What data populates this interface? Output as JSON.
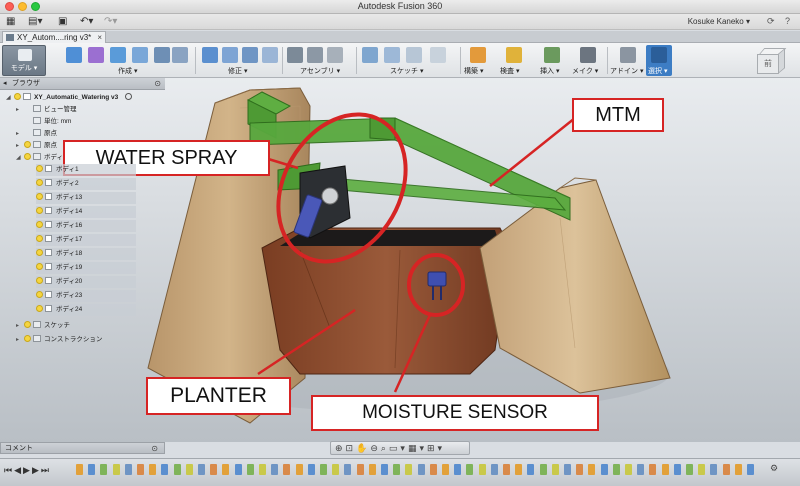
{
  "app": {
    "title": "Autodesk Fusion 360"
  },
  "user": {
    "name": "Kosuke Kaneko ▾"
  },
  "document_tab": {
    "label": "XY_Autom....ring v3*"
  },
  "workspace": {
    "label": "モデル ▾"
  },
  "toolbar": {
    "groups": [
      {
        "label": "作成 ▾"
      },
      {
        "label": "修正 ▾"
      },
      {
        "label": "アセンブリ ▾"
      },
      {
        "label": "スケッチ ▾"
      },
      {
        "label": "構築 ▾"
      },
      {
        "label": "検査 ▾"
      },
      {
        "label": "挿入 ▾"
      },
      {
        "label": "メイク ▾"
      },
      {
        "label": "アドイン ▾"
      },
      {
        "label": "選択 ▾"
      }
    ]
  },
  "viewcube": {
    "face": "前"
  },
  "browser": {
    "title": "ブラウザ",
    "root": "XY_Automatic_Watering v3",
    "items": [
      {
        "label": "ビュー管理"
      },
      {
        "label": "単位: mm"
      },
      {
        "label": "原点"
      },
      {
        "label": "原点"
      },
      {
        "label": "ボディ"
      }
    ],
    "bodies": [
      "ボディ1",
      "ボディ2",
      "ボディ13",
      "ボディ14",
      "ボディ16",
      "ボディ17",
      "ボディ18",
      "ボディ19",
      "ボディ20",
      "ボディ23",
      "ボディ24"
    ],
    "tail": [
      {
        "label": "スケッチ"
      },
      {
        "label": "コンストラクション"
      }
    ]
  },
  "comment_panel": {
    "title": "コメント"
  },
  "annotations": {
    "mtm": "MTM",
    "water_spray": "WATER SPRAY",
    "planter": "PLANTER",
    "moisture_sensor": "MOISTURE SENSOR"
  },
  "colors": {
    "annotation_red": "#d62424",
    "frame_green": "#58a83e",
    "wood": "#c9a77a",
    "planter_brown": "#8a4a2c"
  }
}
